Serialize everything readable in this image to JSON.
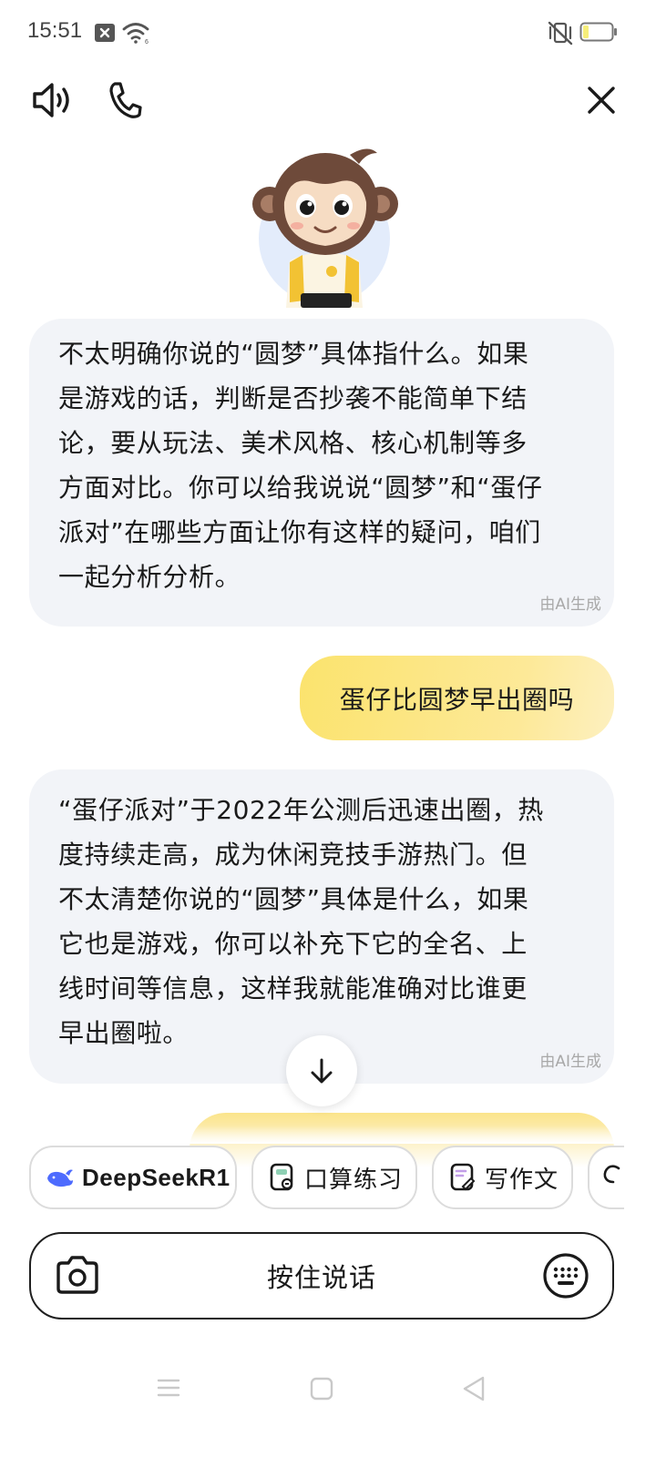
{
  "status_bar": {
    "time": "15:51"
  },
  "top_bar": {
    "speaker_icon": "speaker-icon",
    "phone_icon": "phone-icon",
    "close_icon": "close-icon"
  },
  "messages": [
    {
      "role": "assistant",
      "lines": [
        "不太明确你说的“圆梦”具体指什么。如果",
        "是游戏的话，判断是否抄袭不能简单下结",
        "论，要从玩法、美术风格、核心机制等多",
        "方面对比。你可以给我说说“圆梦”和“蛋仔",
        "派对”在哪些方面让你有这样的疑问，咱们",
        "一起分析分析。"
      ],
      "tag": "由AI生成"
    },
    {
      "role": "user",
      "text": "蛋仔比圆梦早出圈吗"
    },
    {
      "role": "assistant",
      "lines": [
        "“蛋仔派对”于2022年公测后迅速出圈，热",
        "度持续走高，成为休闲竞技手游热门。但",
        "不太清楚你说的“圆梦”具体是什么，如果",
        "它也是游戏，你可以补充下它的全名、上",
        "线时间等信息，这样我就能准确对比谁更",
        "早出圈啦。"
      ],
      "tag": "由AI生成"
    }
  ],
  "chips": [
    {
      "label": "DeepSeekR1",
      "icon": "whale-icon"
    },
    {
      "label": "口算练习",
      "icon": "calc-doc-icon"
    },
    {
      "label": "写作文",
      "icon": "write-doc-icon"
    }
  ],
  "input": {
    "hold_to_talk_label": "按住说话",
    "camera_icon": "camera-icon",
    "keyboard_icon": "keyboard-icon"
  },
  "colors": {
    "user_bubble": "#fbe36d",
    "ai_bubble": "#f2f4f8",
    "deepseek_blue": "#4d6bfe"
  }
}
